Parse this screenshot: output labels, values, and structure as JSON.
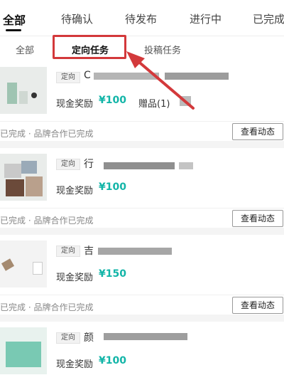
{
  "top_tabs": [
    {
      "label": "全部",
      "active": true
    },
    {
      "label": "待确认",
      "active": false
    },
    {
      "label": "待发布",
      "active": false
    },
    {
      "label": "进行中",
      "active": false
    },
    {
      "label": "已完成",
      "active": false
    }
  ],
  "sub_tabs": [
    {
      "label": "全部",
      "active": false
    },
    {
      "label": "定向任务",
      "active": true
    },
    {
      "label": "投稿任务",
      "active": false
    }
  ],
  "cards": [
    {
      "tag": "定向",
      "name": "C",
      "reward_label": "现金奖励",
      "reward_amount": "¥100",
      "gift": "赠品(1)",
      "status": "已完成 · 品牌合作已完成",
      "action": "查看动态"
    },
    {
      "tag": "定向",
      "name": "行",
      "reward_label": "现金奖励",
      "reward_amount": "¥100",
      "gift": "",
      "status": "已完成 · 品牌合作已完成",
      "action": "查看动态"
    },
    {
      "tag": "定向",
      "name": "吉",
      "reward_label": "现金奖励",
      "reward_amount": "¥150",
      "gift": "",
      "status": "已完成 · 品牌合作已完成",
      "action": "查看动态"
    },
    {
      "tag": "定向",
      "name": "颜",
      "reward_label": "现金奖励",
      "reward_amount": "¥100",
      "gift": "",
      "status": "",
      "action": ""
    }
  ],
  "colors": {
    "accent_teal": "#13b5a8",
    "annotation_red": "#d3393b"
  }
}
